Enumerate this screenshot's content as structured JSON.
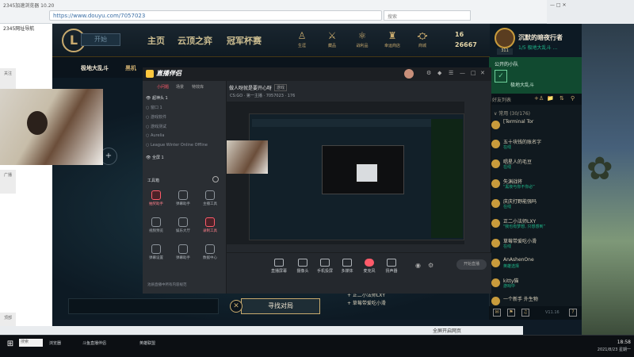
{
  "browser": {
    "title": "2345加速浏览器 10.20",
    "url": "https://www.douyu.com/7057023",
    "search_placeholder": "搜索",
    "fav_label": "2345网址导航"
  },
  "left_sidebar": {
    "items": [
      "关注",
      "广播",
      "顶部"
    ]
  },
  "lol": {
    "logo": "L",
    "play_button": "开始",
    "tabs": [
      "主页",
      "云顶之弈",
      "冠军杯赛"
    ],
    "icon_buttons": [
      {
        "icon": "profile-icon",
        "label": "生涯"
      },
      {
        "icon": "collection-icon",
        "label": "藏品"
      },
      {
        "icon": "loot-icon",
        "label": "战利品"
      },
      {
        "icon": "store-icon",
        "label": "幸运商店"
      },
      {
        "icon": "shop-icon",
        "label": "商城"
      }
    ],
    "rp": "16",
    "be": "26667",
    "sub_tabs": [
      "极地大乱斗",
      "黑机"
    ],
    "find_match": "寻找对局",
    "find_match_cancel": "✕",
    "add_button": "+",
    "profile": {
      "name": "沉默的暗夜行者",
      "status": "1/5 极地大乱斗 …",
      "level": "311"
    },
    "lobby": {
      "title": "公开的小队",
      "mode": "极地大乱斗"
    },
    "friends_title": "好友列表",
    "group_label": "∨ 常用 (30/176)",
    "friends": [
      {
        "name": "[Terminal Tor",
        "status": ""
      },
      {
        "name": "五十块钱的账名字",
        "status": "在线"
      },
      {
        "name": "唱星人的毛豆",
        "status": "在线"
      },
      {
        "name": "失渊战将",
        "status": "\"黑夜与你不你必”"
      },
      {
        "name": "庆庆打野能强吗",
        "status": "在线"
      },
      {
        "name": "正二小法师LXY",
        "status": "\"我也有梦想, 只想感到”"
      },
      {
        "name": "草莓带爱吃小滑",
        "status": "在线"
      },
      {
        "name": "AnAshenOne",
        "status": "英雄选择"
      },
      {
        "name": "kitty猫",
        "status": "游戏中"
      },
      {
        "name": "一个新手 外生物",
        "status": ""
      }
    ],
    "version": "V11.16",
    "lobby_members": [
      "+ 正二小法师LXY",
      "+ 草莓带爱吃小滑"
    ]
  },
  "streamer": {
    "logo": "直播伴侣",
    "tabs": [
      "小问题",
      "场景",
      "特效库"
    ],
    "scenes": [
      {
        "label": "超神头 1",
        "on": true
      },
      {
        "label": "窗口 1",
        "on": false
      },
      {
        "label": "游戏软件",
        "on": false
      },
      {
        "label": "游戏测试",
        "on": false
      },
      {
        "label": "Aurelia",
        "on": false
      },
      {
        "label": "League Winter Online Offline",
        "on": false
      },
      {
        "label": "全屏 1",
        "on": true
      }
    ],
    "tools_title": "工具箱",
    "tools": [
      {
        "label": "抽奖助手",
        "red": true
      },
      {
        "label": "弹幕助手",
        "red": false
      },
      {
        "label": "主播工具",
        "red": false
      },
      {
        "label": "视频预览",
        "red": false
      },
      {
        "label": "娱乐大厅",
        "red": false
      },
      {
        "label": "录制工具",
        "red": true
      },
      {
        "label": "弹幕设置",
        "red": false
      },
      {
        "label": "弹幕助手",
        "red": false
      },
      {
        "label": "数据中心",
        "red": false
      }
    ],
    "warning": "池质直播中所有内容规范",
    "room_title": "做人呀就是要开心呀",
    "room_tag": "游戏",
    "room_meta": "CS:GO · 第一主播 · 7057023 · 176",
    "bottom_buttons": [
      "直播屏幕",
      "摄像头",
      "手机投屏",
      "多媒体",
      "麦克风",
      "扬声器"
    ],
    "start_button": "开始直播"
  },
  "taskbar": {
    "start": "⊞",
    "search_placeholder": "搜索",
    "items": [
      "浏览器",
      "斗鱼直播伴侣",
      "英雄联盟"
    ],
    "time": "18:58",
    "date": "2021/8/23 星期一",
    "under_text": "全屏开启网页"
  },
  "colors": {
    "gold": "#c8aa6e",
    "online": "#1fb78a",
    "lobby_green": "#114a30",
    "live_red": "#ff5b6a"
  }
}
